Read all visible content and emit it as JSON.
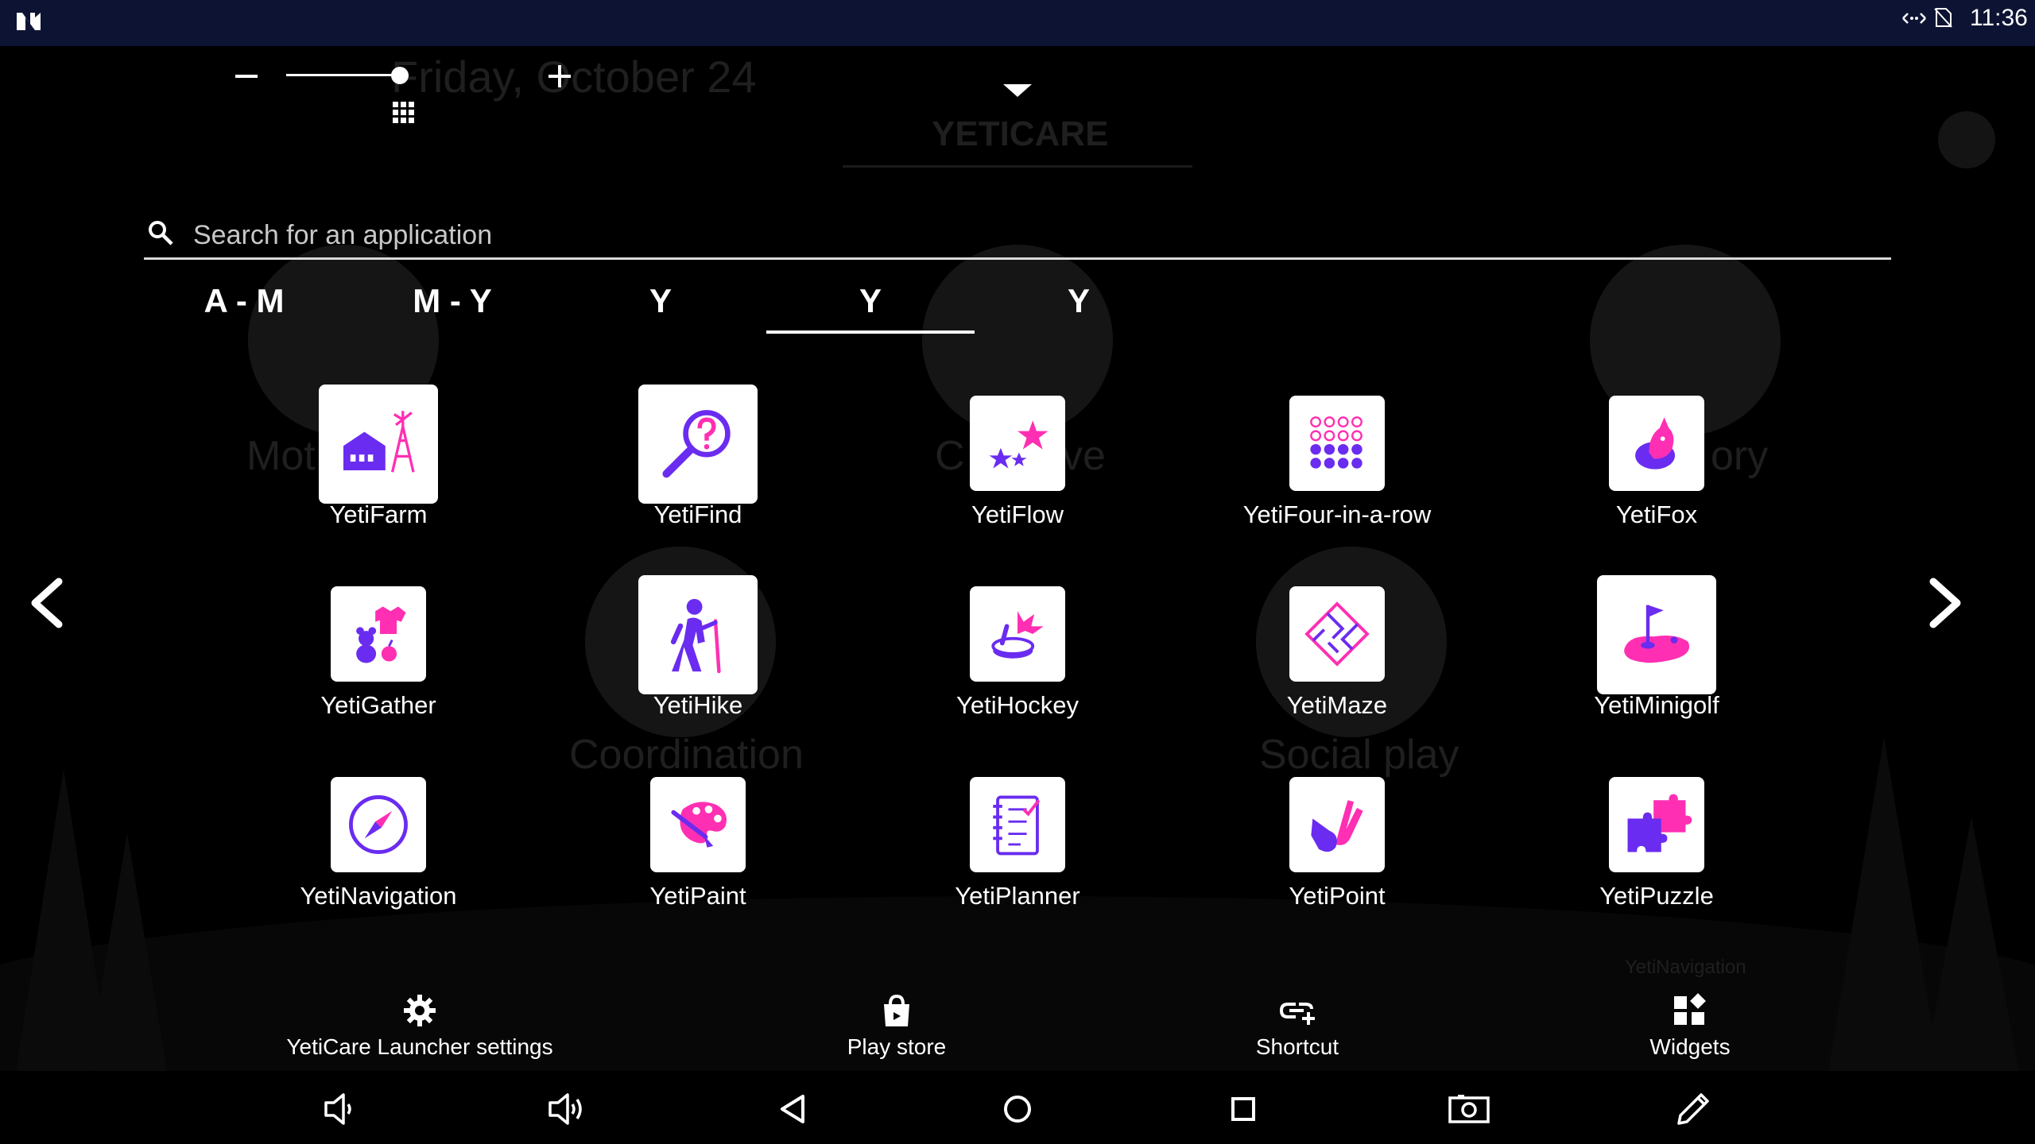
{
  "status_bar": {
    "time": "11:36",
    "icons": [
      "n-logo-icon",
      "link-arrows-icon",
      "no-sim-icon"
    ]
  },
  "background": {
    "date_text": "Friday, October 24",
    "launcher_title": "YETICARE",
    "category_labels": [
      "Mot",
      "C",
      "ve",
      "ory",
      "Coordination",
      "Social play",
      "YetiNavigation"
    ]
  },
  "controls": {
    "zoom": {
      "level": 0.95
    }
  },
  "search": {
    "placeholder": "Search for an application"
  },
  "tabs": [
    {
      "label": "A - M",
      "active": false
    },
    {
      "label": "M - Y",
      "active": false
    },
    {
      "label": "Y",
      "active": false
    },
    {
      "label": "Y",
      "active": true
    },
    {
      "label": "Y",
      "active": false
    }
  ],
  "apps": [
    {
      "name": "YetiFarm",
      "icon": "farm-icon"
    },
    {
      "name": "YetiFind",
      "icon": "magnifier-question-icon"
    },
    {
      "name": "YetiFlow",
      "icon": "stars-icon"
    },
    {
      "name": "YetiFour-in-a-row",
      "icon": "dots-grid-icon"
    },
    {
      "name": "YetiFox",
      "icon": "fox-icon"
    },
    {
      "name": "YetiGather",
      "icon": "toys-icon"
    },
    {
      "name": "YetiHike",
      "icon": "hiker-icon"
    },
    {
      "name": "YetiHockey",
      "icon": "hockey-icon"
    },
    {
      "name": "YetiMaze",
      "icon": "maze-icon"
    },
    {
      "name": "YetiMinigolf",
      "icon": "minigolf-icon"
    },
    {
      "name": "YetiNavigation",
      "icon": "compass-icon"
    },
    {
      "name": "YetiPaint",
      "icon": "palette-icon"
    },
    {
      "name": "YetiPlanner",
      "icon": "checklist-icon"
    },
    {
      "name": "YetiPoint",
      "icon": "hand-point-icon"
    },
    {
      "name": "YetiPuzzle",
      "icon": "puzzle-icon"
    }
  ],
  "bottom_actions": [
    {
      "label": "YetiCare Launcher settings",
      "icon": "gear-icon"
    },
    {
      "label": "Play store",
      "icon": "shopping-bag-icon"
    },
    {
      "label": "Shortcut",
      "icon": "link-plus-icon"
    },
    {
      "label": "Widgets",
      "icon": "widgets-icon"
    }
  ],
  "system_nav": [
    "volume-down-icon",
    "volume-up-icon",
    "back-icon",
    "home-icon",
    "recents-icon",
    "screenshot-icon",
    "pencil-icon"
  ],
  "colors": {
    "accent_purple": "#6a2cf0",
    "accent_pink": "#ff2fb3",
    "status_bar": "#0d1433",
    "background": "#000000"
  }
}
